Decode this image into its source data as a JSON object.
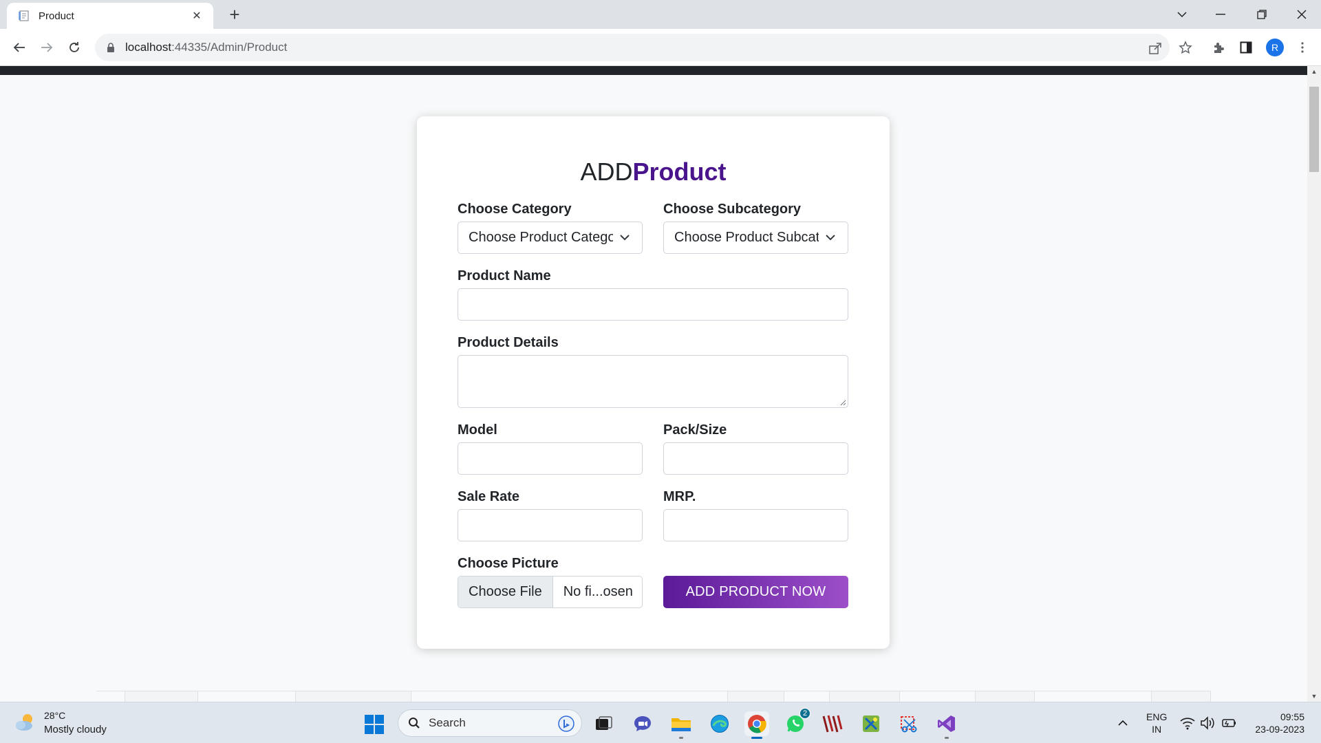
{
  "browser": {
    "tab_title": "Product",
    "url_host": "localhost",
    "url_rest": ":44335/Admin/Product",
    "profile_initial": "R"
  },
  "form": {
    "heading_plain": "ADD",
    "heading_accent": "Product",
    "category_label": "Choose Category",
    "category_value": "Choose Product Category",
    "subcategory_label": "Choose Subcategory",
    "subcategory_value": "Choose Product Subcategory",
    "product_name_label": "Product Name",
    "product_details_label": "Product Details",
    "model_label": "Model",
    "pack_size_label": "Pack/Size",
    "sale_rate_label": "Sale Rate",
    "mrp_label": "MRP.",
    "picture_label": "Choose Picture",
    "file_button": "Choose File",
    "file_status": "No fi...osen",
    "submit_label": "ADD PRODUCT NOW"
  },
  "taskbar": {
    "temperature": "28°C",
    "weather": "Mostly cloudy",
    "search_label": "Search",
    "whatsapp_badge": "2",
    "lang_line1": "ENG",
    "lang_line2": "IN",
    "time": "09:55",
    "date": "23-09-2023"
  },
  "colors": {
    "accent": "#4a148c",
    "button_gradient_start": "#5b1a98",
    "button_gradient_end": "#9d4fc9",
    "page_topbar": "#212529"
  }
}
